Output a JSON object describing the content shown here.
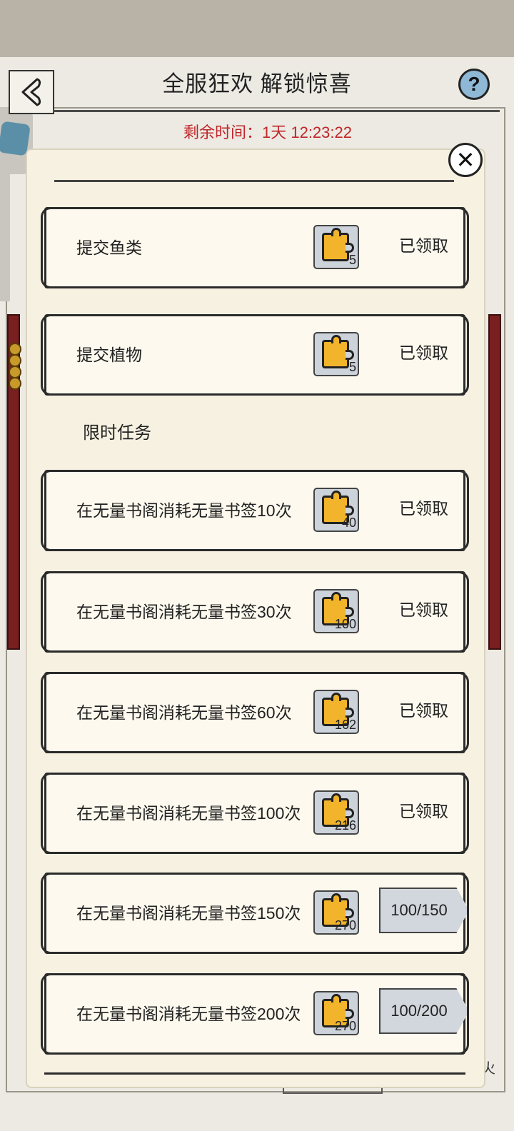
{
  "header": {
    "title": "全服狂欢 解锁惊喜",
    "help_label": "?",
    "countdown": "剩余时间：1天 12:23:22"
  },
  "background": {
    "partial_text": "火"
  },
  "modal": {
    "close_label": "✕",
    "claimed_label": "已领取",
    "section_title": "限时任务",
    "top_tasks": [
      {
        "name": "提交鱼类",
        "reward": "5",
        "status": "已领取"
      },
      {
        "name": "提交植物",
        "reward": "5",
        "status": "已领取"
      }
    ],
    "limited_tasks": [
      {
        "name": "在无量书阁消耗无量书签10次",
        "reward": "40",
        "status": "已领取"
      },
      {
        "name": "在无量书阁消耗无量书签30次",
        "reward": "100",
        "status": "已领取"
      },
      {
        "name": "在无量书阁消耗无量书签60次",
        "reward": "162",
        "status": "已领取"
      },
      {
        "name": "在无量书阁消耗无量书签100次",
        "reward": "216",
        "status": "已领取"
      },
      {
        "name": "在无量书阁消耗无量书签150次",
        "reward": "270",
        "progress": "100/150"
      },
      {
        "name": "在无量书阁消耗无量书签200次",
        "reward": "270",
        "progress": "100/200"
      }
    ]
  },
  "colors": {
    "accent_red": "#c0262a",
    "reward_gold": "#f1b42a",
    "card_bg": "#fdf9ee"
  }
}
